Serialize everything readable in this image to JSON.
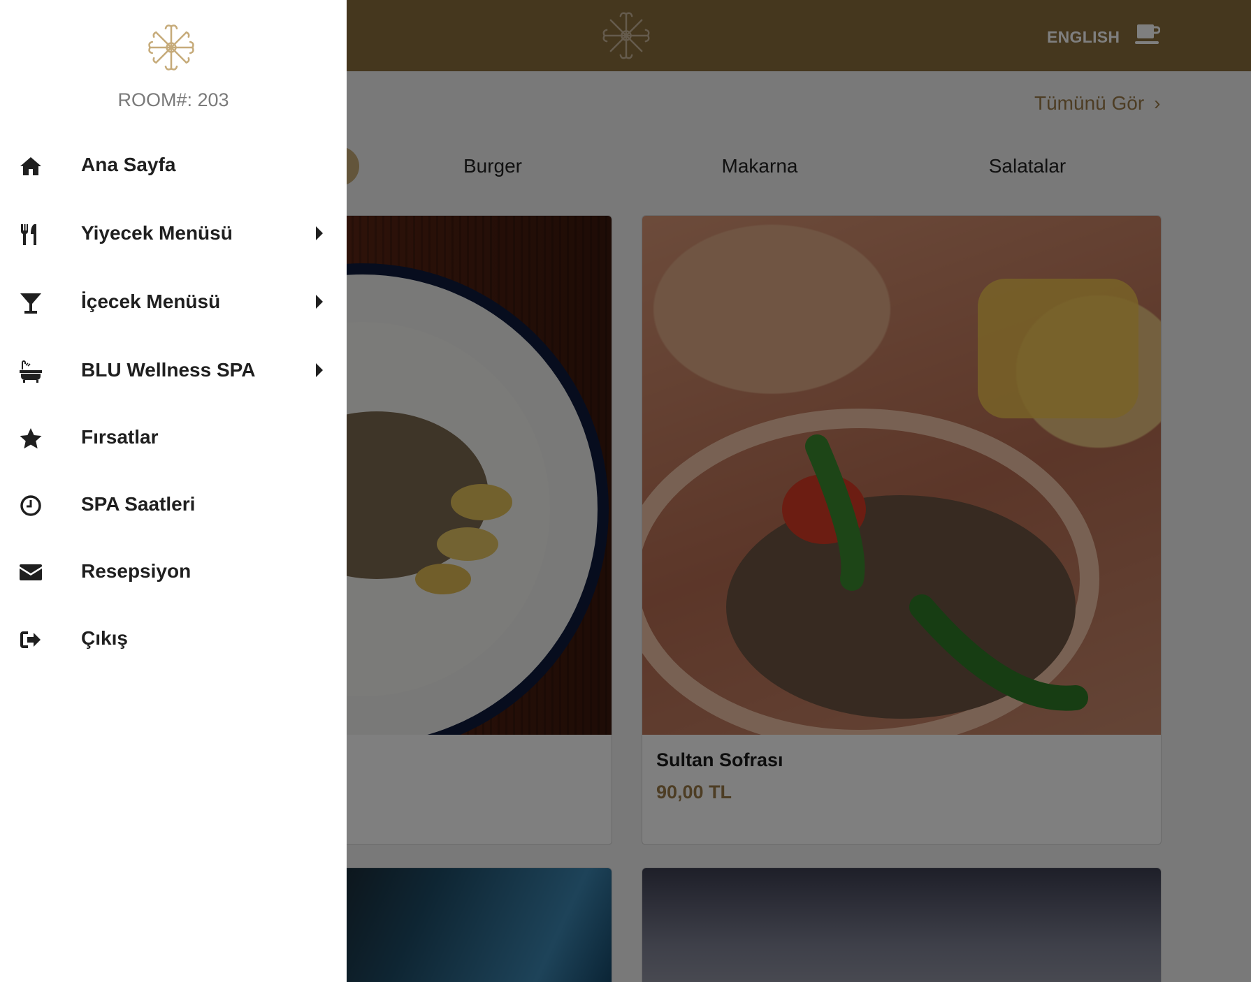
{
  "header": {
    "language_label": "ENGLISH",
    "cart_icon": "coffee-cup-icon",
    "logo_icon": "starburst-logo-icon"
  },
  "content": {
    "see_all_label": "Tümünü Gör",
    "see_all_chevron": "›",
    "categories": [
      "Burger",
      "Makarna",
      "Salatalar"
    ],
    "cards": [
      {
        "title": "",
        "price": ""
      },
      {
        "title": "Sultan Sofrası",
        "price": "90,00 TL"
      },
      {
        "title": "",
        "price": ""
      },
      {
        "title": "",
        "price": ""
      }
    ]
  },
  "drawer": {
    "room_label": "ROOM#: 203",
    "items": [
      {
        "label": "Ana Sayfa",
        "icon": "home-icon",
        "has_submenu": false
      },
      {
        "label": "Yiyecek Menüsü",
        "icon": "utensils-icon",
        "has_submenu": true
      },
      {
        "label": "İçecek Menüsü",
        "icon": "cocktail-glass-icon",
        "has_submenu": true
      },
      {
        "label": "BLU Wellness SPA",
        "icon": "bathtub-icon",
        "has_submenu": true
      },
      {
        "label": "Fırsatlar",
        "icon": "star-icon",
        "has_submenu": false
      },
      {
        "label": "SPA Saatleri",
        "icon": "clock-icon",
        "has_submenu": false
      },
      {
        "label": "Resepsiyon",
        "icon": "envelope-icon",
        "has_submenu": false
      },
      {
        "label": "Çıkış",
        "icon": "sign-out-icon",
        "has_submenu": false
      }
    ]
  },
  "colors": {
    "brand_brown": "#8a6f3c",
    "accent_gold": "#9b7b48",
    "logo_gold": "#c6ab7a"
  }
}
